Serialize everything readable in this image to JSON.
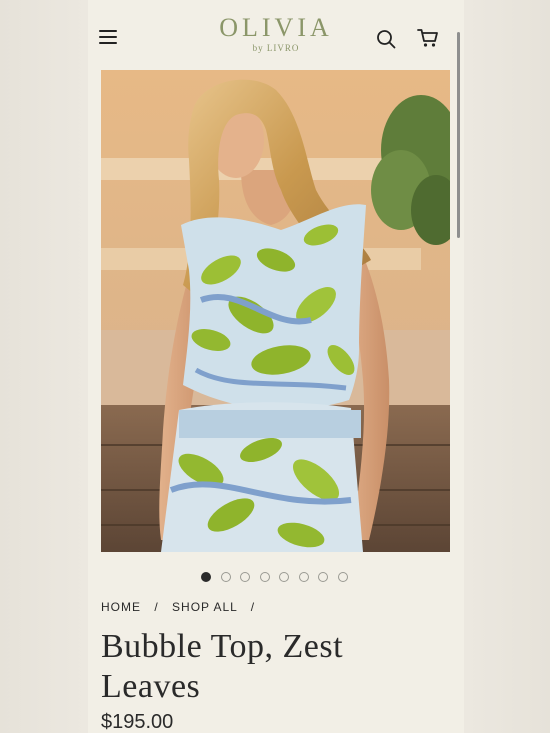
{
  "header": {
    "logo_main": "OLIVIA",
    "logo_sub": "by LIVRO",
    "icons": [
      "menu-icon",
      "search-icon",
      "cart-icon"
    ]
  },
  "gallery": {
    "slide_count": 8,
    "active_index": 0
  },
  "breadcrumb": {
    "home": "HOME",
    "shop_all": "SHOP ALL",
    "separator": "/"
  },
  "product": {
    "title_line1": "Bubble Top, Zest",
    "title_line2": "Leaves",
    "price": "$195.00"
  },
  "colors": {
    "brand": "#8b9669",
    "page_bg": "#f2efe6",
    "text": "#2a2a2a"
  }
}
